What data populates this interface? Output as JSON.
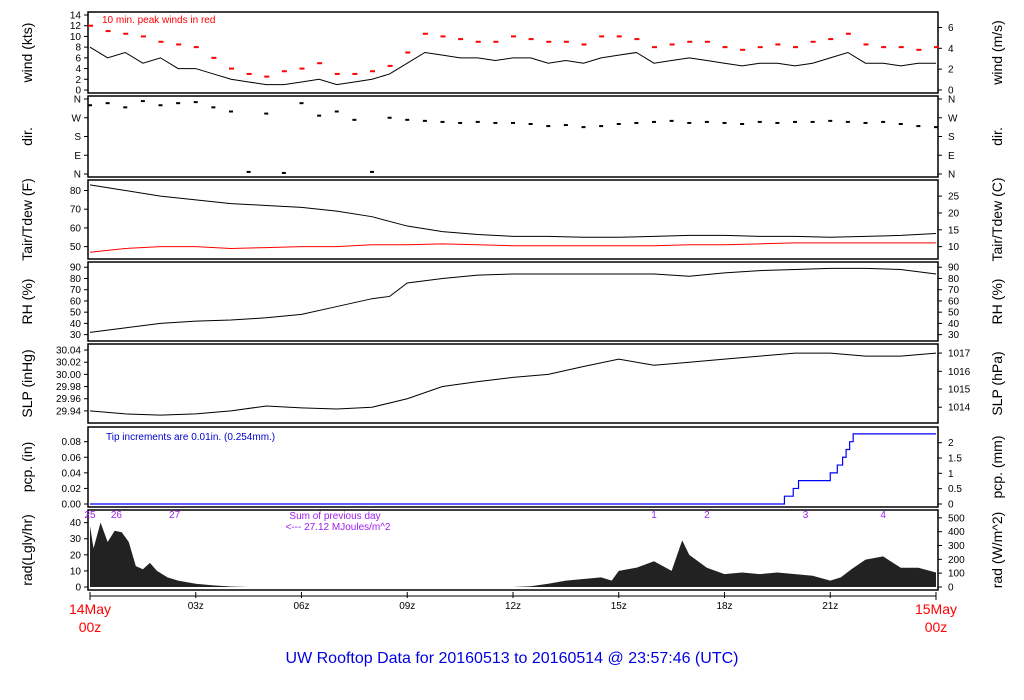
{
  "chart_data": {
    "type": "line",
    "title": "UW Rooftop Data for 20160513  to  20160514 @ 23:57:46  (UTC)",
    "x_range_hours": [
      0,
      24
    ],
    "x_ticks": [
      {
        "h": 3,
        "label": "03z"
      },
      {
        "h": 6,
        "label": "06z"
      },
      {
        "h": 9,
        "label": "09z"
      },
      {
        "h": 12,
        "label": "12z"
      },
      {
        "h": 15,
        "label": "15z"
      },
      {
        "h": 18,
        "label": "18z"
      },
      {
        "h": 21,
        "label": "21z"
      }
    ],
    "x_start": {
      "line1": "14May",
      "line2": "00z"
    },
    "x_end": {
      "line1": "15May",
      "line2": "00z"
    },
    "panels": [
      {
        "name": "wind",
        "ylabel": "wind (kts)",
        "ylabel_right": "wind (m/s)",
        "ylim": [
          0,
          14
        ],
        "yticks": [
          "0",
          "2",
          "4",
          "6",
          "8",
          "10",
          "12",
          "14"
        ],
        "yticks_vals": [
          0,
          2,
          4,
          6,
          8,
          10,
          12,
          14
        ],
        "rticks": [
          "0",
          "2",
          "4",
          "6"
        ],
        "rticks_vals": [
          0,
          3.89,
          7.78,
          11.66
        ],
        "annotation": "10 min. peak winds in red",
        "series": [
          {
            "name": "wind",
            "color": "#000000",
            "style": "line",
            "x": [
              0,
              0.5,
              1,
              1.5,
              2,
              2.5,
              3,
              3.5,
              4,
              4.5,
              5,
              5.5,
              6,
              6.5,
              7,
              7.5,
              8,
              8.5,
              9,
              9.5,
              10,
              10.5,
              11,
              11.5,
              12,
              12.5,
              13,
              13.5,
              14,
              14.5,
              15,
              15.5,
              16,
              16.5,
              17,
              17.5,
              18,
              18.5,
              19,
              19.5,
              20,
              20.5,
              21,
              21.5,
              22,
              22.5,
              23,
              23.5,
              24
            ],
            "y": [
              8,
              6,
              7,
              5,
              6,
              4,
              4,
              3,
              2,
              1.5,
              1,
              1,
              1.5,
              2,
              1,
              1.5,
              2,
              3,
              5,
              7,
              6.5,
              6,
              6,
              5.5,
              6,
              6,
              5,
              5.5,
              5,
              6,
              6.5,
              7,
              5,
              5.5,
              6,
              5.5,
              5,
              4.5,
              5,
              5,
              4.5,
              5,
              6,
              7,
              5,
              5,
              4.5,
              5,
              5
            ]
          },
          {
            "name": "peak",
            "color": "#ff0000",
            "style": "dash",
            "x": [
              0,
              0.5,
              1,
              1.5,
              2,
              2.5,
              3,
              3.5,
              4,
              4.5,
              5,
              5.5,
              6,
              6.5,
              7,
              7.5,
              8,
              8.5,
              9,
              9.5,
              10,
              10.5,
              11,
              11.5,
              12,
              12.5,
              13,
              13.5,
              14,
              14.5,
              15,
              15.5,
              16,
              16.5,
              17,
              17.5,
              18,
              18.5,
              19,
              19.5,
              20,
              20.5,
              21,
              21.5,
              22,
              22.5,
              23,
              23.5,
              24
            ],
            "y": [
              12,
              11,
              10.5,
              10,
              9,
              8.5,
              8,
              6,
              4,
              3,
              2.5,
              3.5,
              4,
              5,
              3,
              3,
              3.5,
              4.5,
              7,
              10.5,
              10,
              9.5,
              9,
              9,
              10,
              9.5,
              9,
              9,
              8.5,
              10,
              10,
              9.5,
              8,
              8.5,
              9,
              9,
              8,
              7.5,
              8,
              8.5,
              8,
              9,
              9.5,
              10.5,
              8.5,
              8,
              8,
              7.5,
              8
            ]
          }
        ]
      },
      {
        "name": "dir",
        "ylabel": "dir.",
        "ylabel_right": "dir.",
        "ylim": [
          0,
          360
        ],
        "yticks": [
          "N",
          "E",
          "S",
          "W",
          "N"
        ],
        "yticks_vals": [
          0,
          90,
          180,
          270,
          360
        ],
        "rticks": [
          "N",
          "E",
          "S",
          "W",
          "N"
        ],
        "rticks_vals": [
          0,
          90,
          180,
          270,
          360
        ],
        "series": [
          {
            "name": "direction",
            "color": "#000000",
            "style": "dots",
            "x": [
              0,
              0.5,
              1,
              1.5,
              2,
              2.5,
              3,
              3.5,
              4,
              4.5,
              5,
              5.5,
              6,
              6.5,
              7,
              7.5,
              8,
              8.5,
              9,
              9.5,
              10,
              10.5,
              11,
              11.5,
              12,
              12.5,
              13,
              13.5,
              14,
              14.5,
              15,
              15.5,
              16,
              16.5,
              17,
              17.5,
              18,
              18.5,
              19,
              19.5,
              20,
              20.5,
              21,
              21.5,
              22,
              22.5,
              23,
              23.5,
              24
            ],
            "y": [
              330,
              340,
              320,
              350,
              330,
              340,
              345,
              320,
              300,
              10,
              290,
              5,
              340,
              280,
              300,
              260,
              10,
              270,
              260,
              255,
              250,
              245,
              250,
              245,
              245,
              240,
              230,
              235,
              225,
              230,
              240,
              245,
              250,
              255,
              245,
              250,
              245,
              240,
              250,
              245,
              250,
              250,
              255,
              250,
              245,
              250,
              240,
              230,
              225
            ]
          }
        ]
      },
      {
        "name": "temp",
        "ylabel": "Tair/Tdew (F)",
        "ylabel_right": "Tair/Tdew (C)",
        "ylim": [
          45,
          84
        ],
        "yticks": [
          "50",
          "60",
          "70",
          "80"
        ],
        "yticks_vals": [
          50,
          60,
          70,
          80
        ],
        "rticks": [
          "10",
          "15",
          "20",
          "25"
        ],
        "rticks_vals": [
          50,
          59,
          68,
          77
        ],
        "series": [
          {
            "name": "Tair",
            "color": "#000000",
            "style": "line",
            "x": [
              0,
              1,
              2,
              3,
              4,
              5,
              6,
              7,
              8,
              9,
              10,
              11,
              12,
              13,
              14,
              15,
              16,
              17,
              18,
              19,
              20,
              21,
              22,
              23,
              24
            ],
            "y": [
              83,
              80,
              77,
              75,
              73,
              72,
              71,
              69,
              66,
              61,
              58,
              56.5,
              55.5,
              55.5,
              55,
              55,
              55.5,
              56,
              56,
              55.5,
              55.5,
              55,
              55.5,
              56,
              57
            ]
          },
          {
            "name": "Tdew",
            "color": "#ff0000",
            "style": "line",
            "x": [
              0,
              1,
              2,
              3,
              4,
              5,
              6,
              7,
              8,
              9,
              10,
              11,
              12,
              13,
              14,
              15,
              16,
              17,
              18,
              19,
              20,
              21,
              22,
              23,
              24
            ],
            "y": [
              47,
              49,
              50,
              50,
              49,
              49.5,
              50,
              50,
              51,
              51,
              51.5,
              51,
              50.5,
              50.5,
              50.5,
              50.5,
              50.5,
              51,
              51,
              51.5,
              52,
              52,
              52,
              52,
              52
            ]
          }
        ]
      },
      {
        "name": "rh",
        "ylabel": "RH (%)",
        "ylabel_right": "RH (%)",
        "ylim": [
          27,
          92
        ],
        "yticks": [
          "30",
          "40",
          "50",
          "60",
          "70",
          "80",
          "90"
        ],
        "yticks_vals": [
          30,
          40,
          50,
          60,
          70,
          80,
          90
        ],
        "rticks": [
          "30",
          "40",
          "50",
          "60",
          "70",
          "80",
          "90"
        ],
        "rticks_vals": [
          30,
          40,
          50,
          60,
          70,
          80,
          90
        ],
        "series": [
          {
            "name": "RH",
            "color": "#000000",
            "style": "line",
            "x": [
              0,
              1,
              2,
              3,
              4,
              5,
              6,
              7,
              8,
              8.5,
              9,
              10,
              11,
              12,
              13,
              14,
              15,
              16,
              17,
              18,
              19,
              20,
              21,
              22,
              23,
              24
            ],
            "y": [
              32,
              36,
              40,
              42,
              43,
              45,
              48,
              55,
              62,
              64,
              76,
              80,
              83,
              84,
              84,
              84,
              84,
              84,
              82,
              85,
              87,
              88,
              89,
              89,
              88,
              84
            ]
          }
        ]
      },
      {
        "name": "slp",
        "ylabel": "SLP (inHg)",
        "ylabel_right": "SLP (hPa)",
        "ylim": [
          29.925,
          30.045
        ],
        "yticks": [
          "29.94",
          "29.96",
          "29.98",
          "30.00",
          "30.02",
          "30.04"
        ],
        "yticks_vals": [
          29.94,
          29.96,
          29.98,
          30.0,
          30.02,
          30.04
        ],
        "rticks": [
          "1014",
          "1015",
          "1016",
          "1017"
        ],
        "rticks_vals": [
          29.946,
          29.976,
          30.005,
          30.035
        ],
        "series": [
          {
            "name": "SLP",
            "color": "#000000",
            "style": "line",
            "x": [
              0,
              1,
              2,
              3,
              4,
              5,
              6,
              7,
              8,
              9,
              10,
              11,
              12,
              13,
              14,
              15,
              16,
              17,
              18,
              19,
              20,
              21,
              22,
              23,
              24
            ],
            "y": [
              29.94,
              29.935,
              29.933,
              29.935,
              29.94,
              29.948,
              29.945,
              29.943,
              29.946,
              29.96,
              29.98,
              29.988,
              29.995,
              30.0,
              30.013,
              30.025,
              30.015,
              30.02,
              30.025,
              30.03,
              30.035,
              30.035,
              30.03,
              30.03,
              30.035
            ]
          }
        ]
      },
      {
        "name": "pcp",
        "ylabel": "pcp. (in)",
        "ylabel_right": "pcp. (mm)",
        "ylim": [
          0,
          0.095
        ],
        "yticks": [
          "0.00",
          "0.02",
          "0.04",
          "0.06",
          "0.08"
        ],
        "yticks_vals": [
          0,
          0.02,
          0.04,
          0.06,
          0.08
        ],
        "rticks": [
          "0",
          "0.5",
          "1",
          "1.5",
          "2"
        ],
        "rticks_vals": [
          0,
          0.0197,
          0.0394,
          0.059,
          0.0787
        ],
        "annotation": "Tip increments are 0.01in. (0.254mm.)",
        "series": [
          {
            "name": "precip",
            "color": "#0000ff",
            "style": "step",
            "x": [
              0,
              19.7,
              19.95,
              20.1,
              21.0,
              21.2,
              21.35,
              21.45,
              21.55,
              21.65,
              24
            ],
            "y": [
              0,
              0.01,
              0.02,
              0.03,
              0.04,
              0.05,
              0.06,
              0.07,
              0.08,
              0.09,
              0.09
            ]
          }
        ]
      },
      {
        "name": "rad",
        "ylabel": "rad(Lgly/hr)",
        "ylabel_right": "rad (W/m^2)",
        "ylim": [
          0,
          46
        ],
        "yticks": [
          "0",
          "10",
          "20",
          "30",
          "40"
        ],
        "yticks_vals": [
          0,
          10,
          20,
          30,
          40
        ],
        "rticks": [
          "0",
          "100",
          "200",
          "300",
          "400",
          "500"
        ],
        "rticks_vals": [
          0,
          8.6,
          17.2,
          25.8,
          34.4,
          43
        ],
        "annotation_line1": "Sum of previous day",
        "annotation_line2": "<--- 27.12 MJoules/m^2",
        "markers": [
          {
            "h": 0,
            "label": "25"
          },
          {
            "h": 0.75,
            "label": "26"
          },
          {
            "h": 2.4,
            "label": "27"
          },
          {
            "h": 16.0,
            "label": "1"
          },
          {
            "h": 17.5,
            "label": "2"
          },
          {
            "h": 20.3,
            "label": "3"
          },
          {
            "h": 22.5,
            "label": "4"
          }
        ],
        "series": [
          {
            "name": "radiation",
            "color": "#222222",
            "style": "area",
            "x": [
              0,
              0.1,
              0.3,
              0.5,
              0.7,
              0.9,
              1.1,
              1.3,
              1.5,
              1.7,
              1.9,
              2.2,
              2.5,
              3,
              3.5,
              4,
              4.5,
              12,
              12.5,
              13,
              13.5,
              14,
              14.5,
              14.8,
              15,
              15.5,
              16,
              16.5,
              16.8,
              17,
              17.5,
              18,
              18.5,
              19,
              19.5,
              20,
              20.5,
              21,
              21.3,
              21.6,
              22,
              22.5,
              23,
              23.5,
              24
            ],
            "y": [
              38,
              24,
              40,
              28,
              35,
              34,
              28,
              13,
              11,
              15,
              10,
              6,
              4,
              2,
              1,
              0.3,
              0,
              0,
              0.5,
              2,
              4,
              5,
              6,
              4,
              10,
              12,
              16,
              10,
              29,
              20,
              12,
              8,
              9,
              8,
              9,
              8,
              7,
              4,
              6,
              11,
              17,
              19,
              12,
              12,
              9
            ]
          }
        ]
      }
    ]
  }
}
